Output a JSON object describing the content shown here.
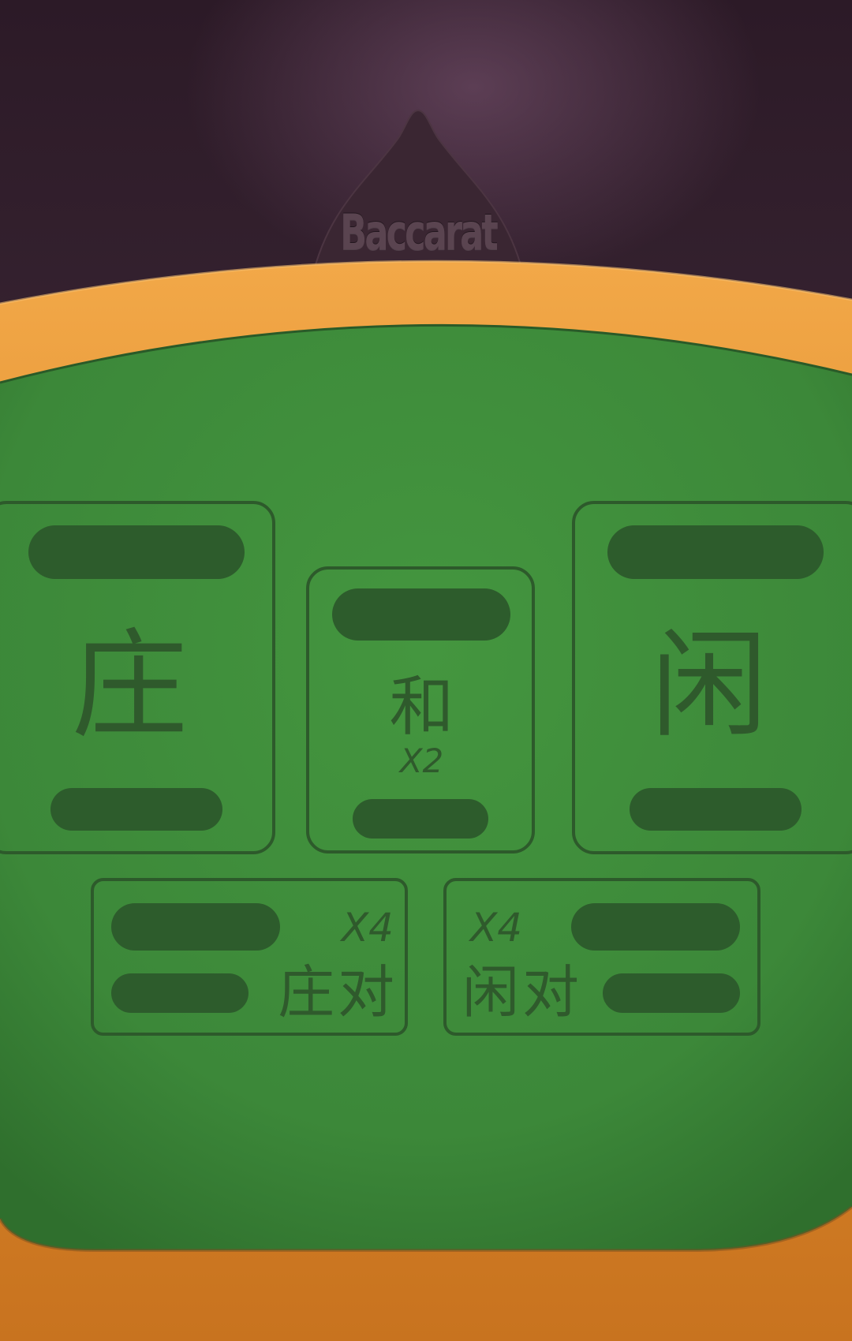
{
  "brand": {
    "title": "Baccarat"
  },
  "bets": {
    "banker": {
      "label": "庄"
    },
    "tie": {
      "label": "和",
      "multiplier": "X2"
    },
    "player": {
      "label": "闲"
    },
    "banker_pair": {
      "label": "庄对",
      "multiplier": "X4"
    },
    "player_pair": {
      "label": "闲对",
      "multiplier": "X4"
    }
  },
  "colors": {
    "felt": "#3f8f3d",
    "rail": "#e08a2e",
    "outline": "#2d5a2b",
    "background": "#2f1d2a"
  }
}
